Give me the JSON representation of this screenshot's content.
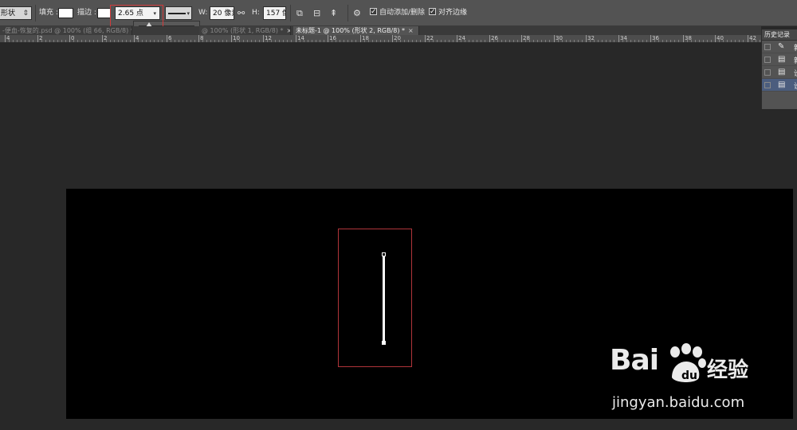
{
  "options_bar": {
    "mode_select": "形状",
    "fill_label": "填充 :",
    "stroke_label": "描边 :",
    "stroke_width_value": "2.65 点",
    "w_label": "W:",
    "w_value": "20 像素",
    "h_label": "H:",
    "h_value": "157 像素",
    "auto_add_delete_label": "自动添加/删除",
    "align_edges_label": "对齐边缘",
    "fill_color": "#ffffff",
    "stroke_color": "#ffffff"
  },
  "tabs": [
    {
      "label": "-便血-恢复的.psd @ 100% (组 66, RGB/8) *",
      "active": false
    },
    {
      "label": "@ 100% (形状 1, RGB/8) *",
      "active": false
    },
    {
      "label": "未标题-1 @ 100% (形状 2, RGB/8) *",
      "active": true
    }
  ],
  "ruler": {
    "labels": [
      "4",
      "2",
      "0",
      "2",
      "4",
      "6",
      "8",
      "10",
      "12",
      "14",
      "16",
      "18",
      "20",
      "22",
      "24",
      "26",
      "28",
      "30",
      "32",
      "34",
      "36",
      "38",
      "40",
      "42"
    ]
  },
  "history_panel": {
    "title": "历史记录",
    "items": [
      {
        "icon": "pen-icon",
        "text": "新",
        "selected": false
      },
      {
        "icon": "document-icon",
        "text": "新",
        "selected": false
      },
      {
        "icon": "document-icon",
        "text": "设",
        "selected": false
      },
      {
        "icon": "document-icon",
        "text": "设",
        "selected": true
      }
    ]
  },
  "watermark": {
    "logo_text": "Bai",
    "logo_text_suffix": "经验",
    "site": "jingyan.baidu.com"
  },
  "colors": {
    "canvas": "#000000",
    "workspace": "#282828",
    "highlight": "#d23a3a",
    "selection_accent": "#4b5d7e"
  }
}
